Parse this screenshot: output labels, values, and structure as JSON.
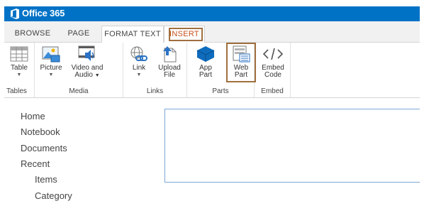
{
  "suite": {
    "title": "Office 365",
    "logo": "office-logo-icon",
    "bar_color": "#0072c6"
  },
  "tabs": [
    {
      "label": "BROWSE"
    },
    {
      "label": "PAGE"
    },
    {
      "label": "FORMAT TEXT"
    },
    {
      "label": "INSERT"
    }
  ],
  "accent_color": "#c7501b",
  "highlight_color": "#a0703f",
  "ribbon": {
    "groups": {
      "tables": {
        "label": "Tables",
        "buttons": [
          {
            "label": "Table",
            "icon": "table-icon"
          }
        ]
      },
      "media": {
        "label": "Media",
        "buttons": [
          {
            "label": "Picture",
            "icon": "picture-icon"
          },
          {
            "label1": "Video and",
            "label2": "Audio",
            "icon": "video-audio-icon"
          }
        ]
      },
      "links": {
        "label": "Links",
        "buttons": [
          {
            "label": "Link",
            "icon": "link-icon"
          },
          {
            "label1": "Upload",
            "label2": "File",
            "icon": "upload-file-icon"
          }
        ]
      },
      "parts": {
        "label": "Parts",
        "buttons": [
          {
            "label1": "App",
            "label2": "Part",
            "icon": "app-part-icon"
          },
          {
            "label1": "Web",
            "label2": "Part",
            "icon": "web-part-icon"
          }
        ]
      },
      "embed": {
        "label": "Embed",
        "buttons": [
          {
            "label1": "Embed",
            "label2": "Code",
            "icon": "embed-code-icon"
          }
        ]
      }
    }
  },
  "nav": [
    {
      "label": "Home"
    },
    {
      "label": "Notebook"
    },
    {
      "label": "Documents"
    },
    {
      "label": "Recent"
    },
    {
      "label": "Items"
    },
    {
      "label": "Category"
    }
  ]
}
